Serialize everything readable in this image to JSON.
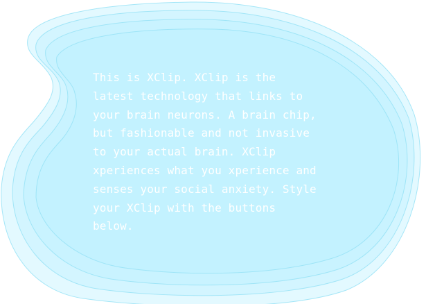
{
  "speech_bubble": {
    "lines": [
      "This is XClip. XClip is the",
      "latest technology that links to",
      "your brain neurons. A brain chip,",
      "but fashionable and not invasive",
      "to your actual brain. XClip",
      "xperiences what you xperience and",
      "senses your social anxiety. Style",
      "your XClip with the buttons",
      "below."
    ]
  },
  "colors": {
    "blob_fill": "#bdf1ff",
    "blob_stroke": "#97e2f6",
    "text": "#ffffff"
  }
}
